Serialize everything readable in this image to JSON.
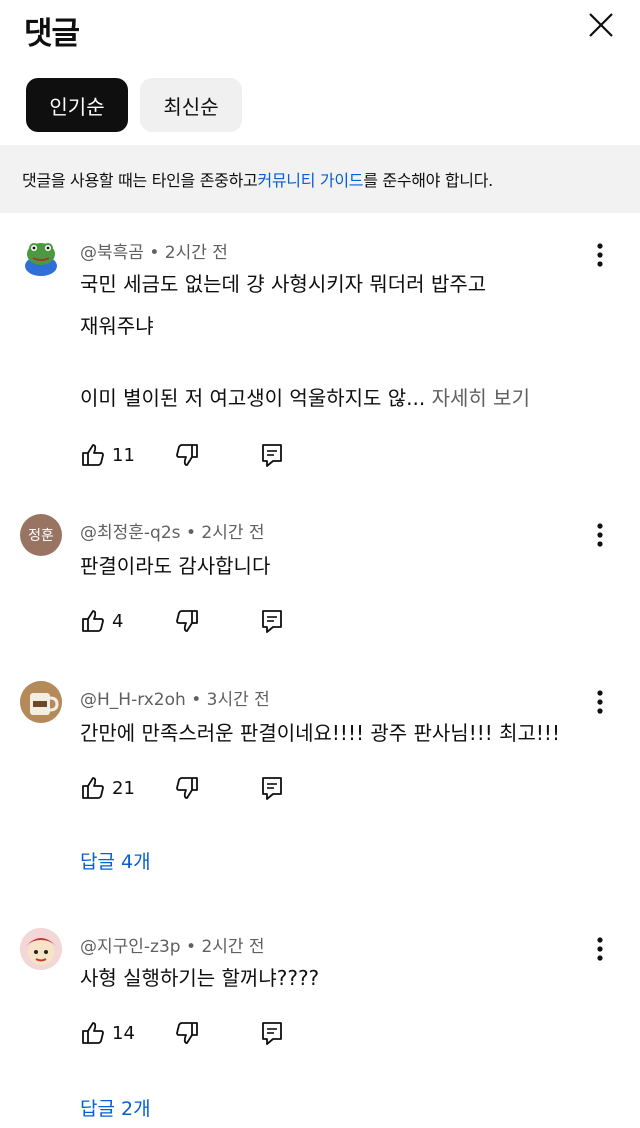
{
  "header": {
    "title": "댓글"
  },
  "sort_tabs": [
    {
      "label": "인기순",
      "active": true
    },
    {
      "label": "최신순",
      "active": false
    }
  ],
  "notice": {
    "before": "댓글을 사용할 때는 타인을 존중하고 ",
    "link": "커뮤니티 가이드",
    "after": "를 준수해야 합니다."
  },
  "colors": {
    "accent": "#065fd4",
    "active_chip": "#0f0f0f",
    "meta_text": "#606060"
  },
  "comments": [
    {
      "author": "@북흑곰",
      "time": "2시간 전",
      "lines": [
        "국민 세금도 없는데 걍 사형시키자 뭐더러 밥주고",
        "재워주냐",
        "",
        "이미 별이된 저 여고생이 억울하지도 않..."
      ],
      "more": "자세히 보기",
      "likes": "11",
      "avatar": "frog-avatar"
    },
    {
      "author": "@최정훈-q2s",
      "time": "2시간 전",
      "lines": [
        "판결이라도 감사합니다"
      ],
      "likes": "4",
      "avatar_text": "정훈"
    },
    {
      "author": "@H_H-rx2oh",
      "time": "3시간 전",
      "lines": [
        "간만에 만족스러운 판결이네요!!!! 광주 판사님!!! 최고!!!"
      ],
      "likes": "21",
      "replies": "답글 4개",
      "avatar": "coffee-cup-avatar"
    },
    {
      "author": "@지구인-z3p",
      "time": "2시간 전",
      "lines": [
        "사형 실행하기는 할꺼냐????"
      ],
      "likes": "14",
      "replies": "답글 2개",
      "avatar": "cartoon-avatar"
    }
  ]
}
